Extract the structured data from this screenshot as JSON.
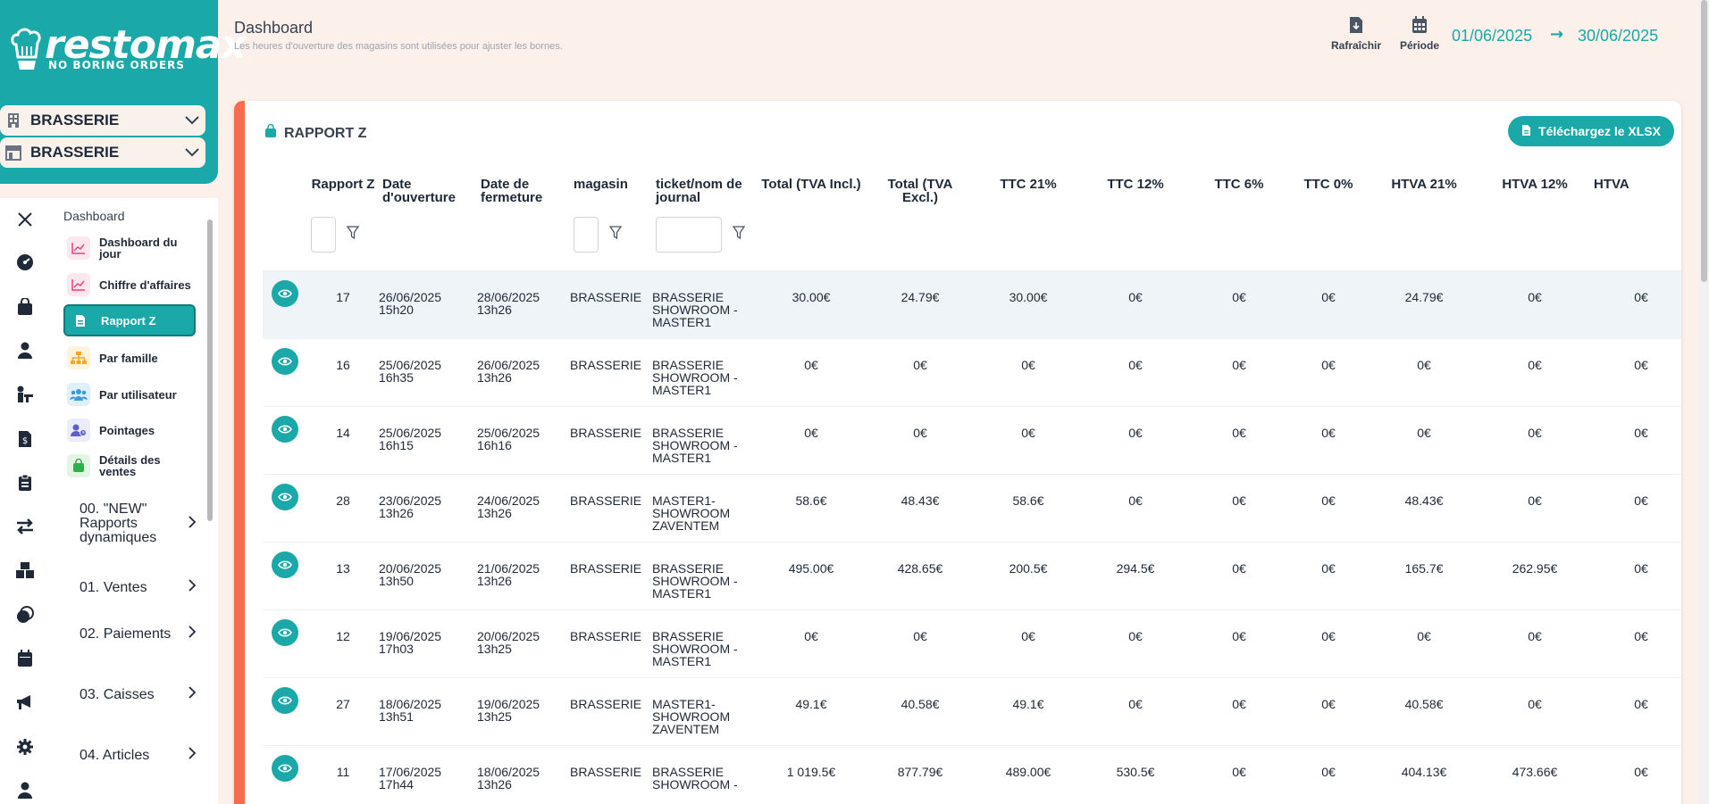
{
  "brand": {
    "wordmark": "restomax",
    "tagline": "NO BORING ORDERS",
    "accent": "#1aa8a8"
  },
  "selectors": [
    {
      "label": "BRASSERIE",
      "icon": "building-icon"
    },
    {
      "label": "BRASSERIE",
      "icon": "store-icon"
    }
  ],
  "rail": [
    "close-icon",
    "gauge-icon",
    "bag-icon",
    "user-icon",
    "people-icon",
    "invoice-icon",
    "clipboard-icon",
    "transfer-icon",
    "boxes-icon",
    "coins-icon",
    "calendar-icon",
    "megaphone-icon",
    "gear-icon",
    "person-icon"
  ],
  "menu": {
    "heading": "Dashboard",
    "items": [
      {
        "label": "Dashboard du jour",
        "icon": "chart-line-icon"
      },
      {
        "label": "Chiffre d'affaires",
        "icon": "chart-line-icon"
      },
      {
        "label": "Rapport Z",
        "icon": "document-icon",
        "active": true
      },
      {
        "label": "Par famille",
        "icon": "sitemap-icon"
      },
      {
        "label": "Par utilisateur",
        "icon": "users-icon"
      },
      {
        "label": "Pointages",
        "icon": "user-clock-icon"
      },
      {
        "label": "Détails des ventes",
        "icon": "shopping-bag-icon"
      }
    ],
    "groups": [
      "00. \"NEW\" Rapports dynamiques",
      "01. Ventes",
      "02. Paiements",
      "03. Caisses",
      "04. Articles"
    ]
  },
  "header": {
    "title": "Dashboard",
    "subtitle": "Les heures d'ouverture des magasins sont utilisées pour ajuster les bornes.",
    "refresh_label": "Rafraîchir",
    "period_label": "Période",
    "date_from": "01/06/2025",
    "date_to": "30/06/2025",
    "arrow": "→"
  },
  "card": {
    "title": "RAPPORT Z",
    "download_label": "Téléchargez le XLSX",
    "columns": [
      "Rapport Z",
      "Date d'ouverture",
      "Date de fermeture",
      "magasin",
      "ticket/nom de journal",
      "Total (TVA Incl.)",
      "Total (TVA Excl.)",
      "TTC 21%",
      "TTC 12%",
      "TTC 6%",
      "TTC 0%",
      "HTVA 21%",
      "HTVA 12%",
      "HTVA"
    ],
    "rows": [
      [
        "17",
        "26/06/2025 15h20",
        "28/06/2025 13h26",
        "BRASSERIE",
        "BRASSERIE SHOWROOM - MASTER1",
        "30.00€",
        "24.79€",
        "30.00€",
        "0€",
        "0€",
        "0€",
        "24.79€",
        "0€",
        "0€"
      ],
      [
        "16",
        "25/06/2025 16h35",
        "26/06/2025 13h26",
        "BRASSERIE",
        "BRASSERIE SHOWROOM - MASTER1",
        "0€",
        "0€",
        "0€",
        "0€",
        "0€",
        "0€",
        "0€",
        "0€",
        "0€"
      ],
      [
        "14",
        "25/06/2025 16h15",
        "25/06/2025 16h16",
        "BRASSERIE",
        "BRASSERIE SHOWROOM - MASTER1",
        "0€",
        "0€",
        "0€",
        "0€",
        "0€",
        "0€",
        "0€",
        "0€",
        "0€"
      ],
      [
        "28",
        "23/06/2025 13h26",
        "24/06/2025 13h26",
        "BRASSERIE",
        "MASTER1-SHOWROOM ZAVENTEM",
        "58.6€",
        "48.43€",
        "58.6€",
        "0€",
        "0€",
        "0€",
        "48.43€",
        "0€",
        "0€"
      ],
      [
        "13",
        "20/06/2025 13h50",
        "21/06/2025 13h26",
        "BRASSERIE",
        "BRASSERIE SHOWROOM - MASTER1",
        "495.00€",
        "428.65€",
        "200.5€",
        "294.5€",
        "0€",
        "0€",
        "165.7€",
        "262.95€",
        "0€"
      ],
      [
        "12",
        "19/06/2025 17h03",
        "20/06/2025 13h25",
        "BRASSERIE",
        "BRASSERIE SHOWROOM - MASTER1",
        "0€",
        "0€",
        "0€",
        "0€",
        "0€",
        "0€",
        "0€",
        "0€",
        "0€"
      ],
      [
        "27",
        "18/06/2025 13h51",
        "19/06/2025 13h25",
        "BRASSERIE",
        "MASTER1-SHOWROOM ZAVENTEM",
        "49.1€",
        "40.58€",
        "49.1€",
        "0€",
        "0€",
        "0€",
        "40.58€",
        "0€",
        "0€"
      ],
      [
        "11",
        "17/06/2025 17h44",
        "18/06/2025 13h26",
        "BRASSERIE",
        "BRASSERIE SHOWROOM -",
        "1 019.5€",
        "877.79€",
        "489.00€",
        "530.5€",
        "0€",
        "0€",
        "404.13€",
        "473.66€",
        "0€"
      ]
    ]
  },
  "colors": {
    "accent": "#1aa8a8",
    "card_border": "#f76b4e",
    "background": "#fbf1ea"
  }
}
